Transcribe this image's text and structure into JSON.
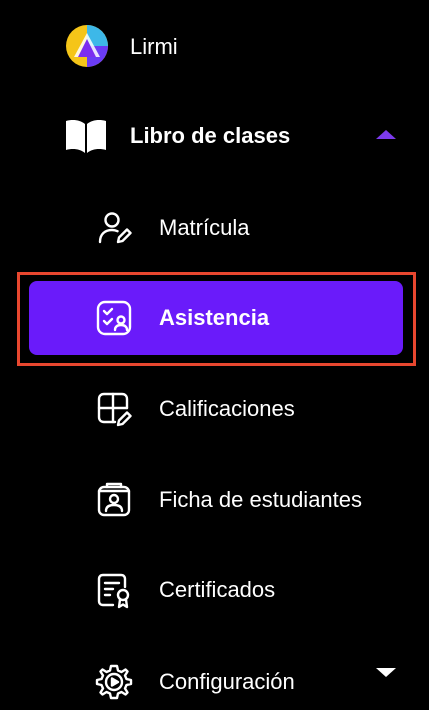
{
  "brand": {
    "name": "Lirmi",
    "icon": "lirmi-logo"
  },
  "nav": {
    "section": {
      "label": "Libro de clases",
      "icon": "book-open-icon",
      "expanded": true,
      "caret": "caret-up-icon",
      "caret_color": "#7c3aed"
    },
    "items": [
      {
        "label": "Matrícula",
        "icon": "user-edit-icon",
        "active": false
      },
      {
        "label": "Asistencia",
        "icon": "attendance-icon",
        "active": true
      },
      {
        "label": "Calificaciones",
        "icon": "grid-edit-icon",
        "active": false
      },
      {
        "label": "Ficha de estudiantes",
        "icon": "student-card-icon",
        "active": false
      },
      {
        "label": "Certificados",
        "icon": "certificate-icon",
        "active": false
      }
    ],
    "config": {
      "label": "Configuración",
      "icon": "gear-play-icon",
      "caret": "caret-down-icon"
    }
  },
  "colors": {
    "background": "#000000",
    "active_item_bg": "#6a1bfa",
    "highlight_border": "#e8472f",
    "text": "#ffffff"
  }
}
